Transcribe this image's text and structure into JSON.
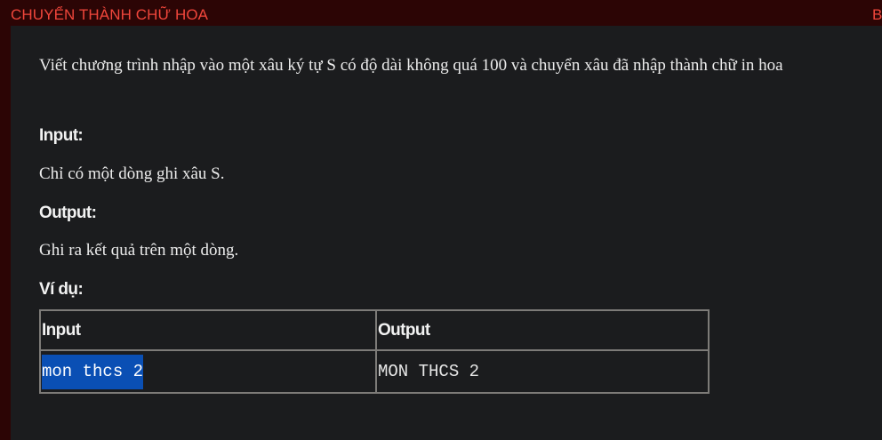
{
  "window": {
    "title": "CHUYỂN THÀNH CHỮ HOA",
    "title_right_fragment": "B"
  },
  "problem": {
    "description": "Viết chương trình nhập vào một xâu ký tự S có độ dài không quá 100 và chuyển xâu đã nhập thành chữ in hoa",
    "input_heading": "Input:",
    "input_text": "Chỉ có một dòng ghi xâu S.",
    "output_heading": "Output:",
    "output_text": "Ghi ra kết quả trên một dòng.",
    "example_heading": "Ví dụ:"
  },
  "example_table": {
    "headers": [
      "Input",
      "Output"
    ],
    "rows": [
      [
        "mon thcs 2",
        "MON THCS 2"
      ]
    ]
  },
  "colors": {
    "title_red": "#f0463b",
    "frame_dark_red": "#2c0505",
    "background": "#1b1c1e",
    "selection_blue": "#0a4fb4"
  }
}
